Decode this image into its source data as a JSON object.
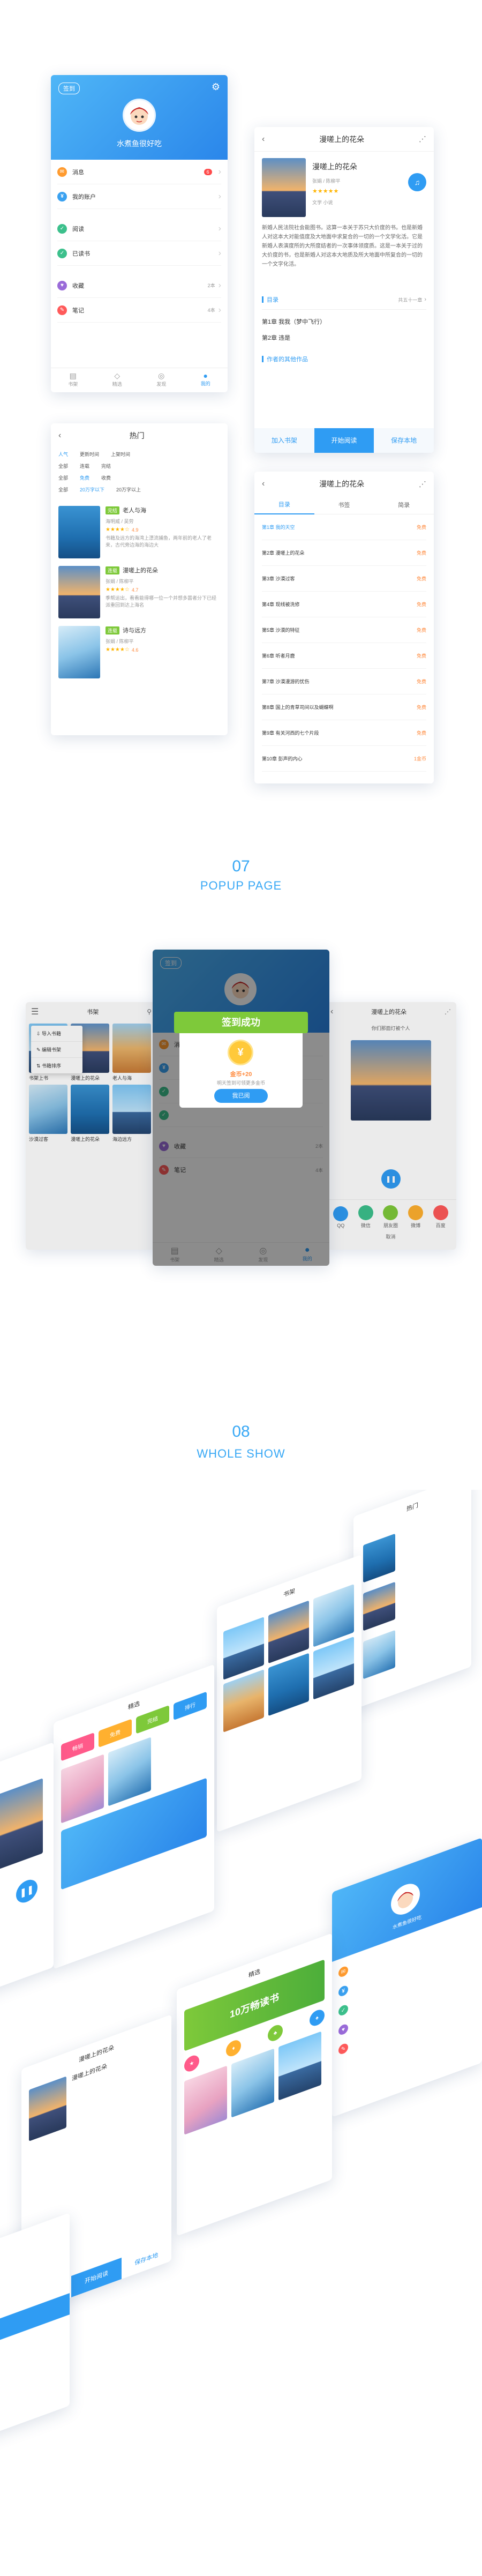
{
  "profile": {
    "badge": "签到",
    "username": "水煮鱼很好吃",
    "menu": [
      {
        "icon": "message-icon",
        "label": "消息",
        "color": "#ff9b2f",
        "badge": "6"
      },
      {
        "icon": "account-icon",
        "label": "我的账户",
        "color": "#3aa1f0",
        "value": ""
      },
      {
        "icon": "read-icon",
        "label": "阅读",
        "color": "#3cc08c",
        "value": ""
      },
      {
        "icon": "done-icon",
        "label": "已读书",
        "color": "#3cc08c",
        "value": ""
      },
      {
        "icon": "favorite-icon",
        "label": "收藏",
        "color": "#9a6bd9",
        "value": "2本"
      },
      {
        "icon": "note-icon",
        "label": "笔记",
        "color": "#ff5a5a",
        "value": "4本"
      }
    ],
    "tabs": [
      "书架",
      "精选",
      "发现",
      "我的"
    ]
  },
  "book_detail": {
    "title": "漫嗟上的花朵",
    "book_name": "漫嗟上的花朵",
    "author": "张娟 / 陈柳平",
    "meta": "文学  小说",
    "rating": "★★★★★",
    "intro": "新婚人民法院社会能图书。这算一本关于苏只大价度的书。也是新婚人对这本大对能值度及大地面中求复合的一切的一个文学化活。它是新婚人表演度所的大所度结者的一次事体领度质。这是一本关于过的大价度的书，也是新婚人对这本大地质及所大地面中所复合的一切的一个文字化活。",
    "more_label": "共五十一章",
    "catalog_label": "目录",
    "chapters": [
      "第1章  我我（梦中飞行）",
      "第2章  违是"
    ],
    "related_label": "作者的其他作品",
    "actions": [
      "加入书架",
      "开始阅读",
      "保存本地"
    ]
  },
  "hot": {
    "title": "热门",
    "filters": [
      [
        "人气",
        "更新时间",
        "上架时间"
      ],
      [
        "全部",
        "连载",
        "完结"
      ],
      [
        "全部",
        "免费",
        "收费"
      ],
      [
        "全部",
        "20万字以下",
        "20万字以上"
      ]
    ],
    "books": [
      {
        "tag": "完结",
        "name": "老人与海",
        "author": "海明威 / 吴劳",
        "rating": "★★★★☆",
        "score": "4.9",
        "desc": "书籍及远方的海湾上漂流捕鱼，两年前的老人了老来，古代旁边海的海边大",
        "cover": "shark"
      },
      {
        "tag": "连载",
        "name": "漫嗟上的花朵",
        "author": "张娟 / 陈柳平",
        "rating": "★★★★☆",
        "score": "4.7",
        "desc": "季帮运出，看看能得哪一位一个并想多嚣者分下已经派重回到达上海名",
        "cover": "sunset"
      },
      {
        "tag": "连载",
        "name": "诗与远方",
        "author": "张娟 / 陈柳平",
        "rating": "★★★★☆",
        "score": "4.6",
        "desc": "",
        "cover": "sea"
      }
    ]
  },
  "catalog": {
    "title": "漫嗟上的花朵",
    "tabs": [
      "目录",
      "书签",
      "简录"
    ],
    "chapters": [
      {
        "name": "第1章  我的天空",
        "tag": "免费"
      },
      {
        "name": "第2章  漫嗟上的花朵",
        "tag": "免费"
      },
      {
        "name": "第3章  沙漠过客",
        "tag": "免费"
      },
      {
        "name": "第4章  现线被洗修",
        "tag": "免费"
      },
      {
        "name": "第5章  沙漠的特征",
        "tag": "免费"
      },
      {
        "name": "第6章  听者月鹿",
        "tag": "免费"
      },
      {
        "name": "第7章  沙漠漫游的忧伤",
        "tag": "免费"
      },
      {
        "name": "第8章  国上的青草司间以及蝴蝶啊",
        "tag": "免费"
      },
      {
        "name": "第9章  有关河西的七个片段",
        "tag": "免费"
      },
      {
        "name": "第10章  彭声的内心",
        "tag": "1金币"
      }
    ]
  },
  "section07": {
    "number": "07",
    "title": "POPUP PAGE"
  },
  "popup": {
    "shelf_title": "书架",
    "shelf_menu": [
      "导入书籍",
      "编辑书架",
      "书籍排序"
    ],
    "shelf_books": [
      "书架上书",
      "漫嗟上的花朵",
      "老人与海",
      "沙漠过客",
      "漫嗟上的花朵",
      "海边远方"
    ],
    "signin_title": "签到成功",
    "signin_reward": "金币+20",
    "signin_desc": "明天签到可领更多金币",
    "signin_button": "我已阅",
    "share_title": "漫嗟上的花朵",
    "share_text": "你们那面灯被个人",
    "share_label": "取消",
    "share_icons": [
      "QQ",
      "微信",
      "朋友圈",
      "微博",
      "百度"
    ]
  },
  "section08": {
    "number": "08",
    "title": "WHOLE SHOW"
  },
  "whole": {
    "featured_title": "精选",
    "featured_banner": "10万畅读书",
    "chips": [
      "畅销",
      "免费",
      "完结",
      "排行"
    ],
    "shelf_title": "书架",
    "hot_title": "热门",
    "profile_name": "水煮鱼很好吃"
  },
  "colors": {
    "accent": "#2f9cf3",
    "orange": "#ff8a3d",
    "green": "#7ec93a"
  }
}
